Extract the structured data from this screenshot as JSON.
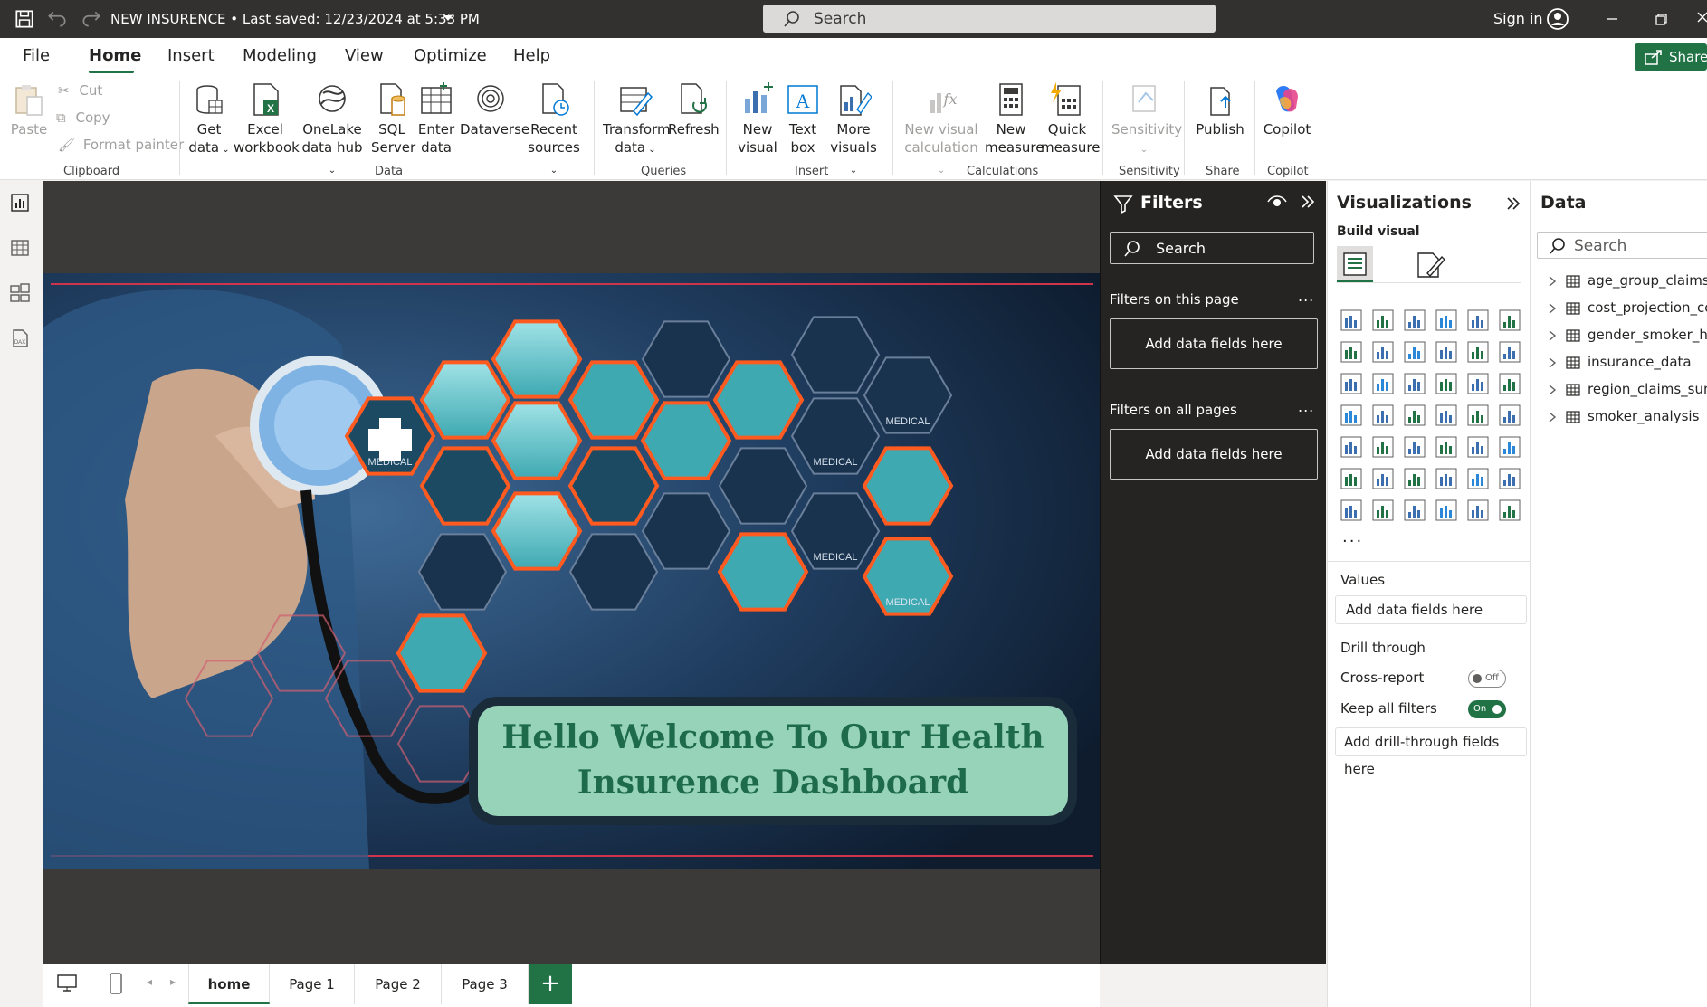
{
  "titlebar": {
    "title": "NEW INSURENCE • Last saved: 12/23/2024 at 5:33 PM",
    "search_placeholder": "Search",
    "signin": "Sign in"
  },
  "menu": {
    "tabs": [
      "File",
      "Home",
      "Insert",
      "Modeling",
      "View",
      "Optimize",
      "Help"
    ],
    "active": "Home",
    "share": "Share"
  },
  "ribbon": {
    "clipboard": {
      "paste": "Paste",
      "cut": "Cut",
      "copy": "Copy",
      "format_painter": "Format painter",
      "label": "Clipboard"
    },
    "data": {
      "get_data": [
        "Get",
        "data"
      ],
      "excel": [
        "Excel",
        "workbook"
      ],
      "onelake": [
        "OneLake",
        "data hub"
      ],
      "sql": [
        "SQL",
        "Server"
      ],
      "enter": [
        "Enter",
        "data"
      ],
      "dataverse": "Dataverse",
      "recent": [
        "Recent",
        "sources"
      ],
      "label": "Data"
    },
    "queries": {
      "transform": [
        "Transform",
        "data"
      ],
      "refresh": "Refresh",
      "label": "Queries"
    },
    "insert": {
      "new_visual": [
        "New",
        "visual"
      ],
      "text_box": [
        "Text",
        "box"
      ],
      "more_visuals": [
        "More",
        "visuals"
      ],
      "label": "Insert"
    },
    "calculations": {
      "new_visual_calc": [
        "New visual",
        "calculation"
      ],
      "new_measure": [
        "New",
        "measure"
      ],
      "quick_measure": [
        "Quick",
        "measure"
      ],
      "label": "Calculations"
    },
    "sensitivity": {
      "btn": "Sensitivity",
      "label": "Sensitivity"
    },
    "share": {
      "publish": "Publish",
      "label": "Share"
    },
    "copilot": {
      "btn": "Copilot",
      "label": "Copilot"
    }
  },
  "canvas": {
    "welcome_line1": "Hello Welcome To Our Health",
    "welcome_line2": "Insurence Dashboard",
    "hex_labels": [
      "MEDICAL",
      "MEDICAL",
      "MEDICAL",
      "MEDICAL",
      "MEDICAL",
      "MEDICAL"
    ]
  },
  "pages": {
    "tabs": [
      "home",
      "Page 1",
      "Page 2",
      "Page 3"
    ],
    "active": "home",
    "add": "+"
  },
  "filters": {
    "title": "Filters",
    "search": "Search",
    "on_this_page": "Filters on this page",
    "on_all_pages": "Filters on all pages",
    "dots": "...",
    "add_fields": "Add data fields here"
  },
  "visualizations": {
    "title": "Visualizations",
    "build_visual": "Build visual",
    "values": "Values",
    "add_fields": "Add data fields here",
    "drill_through": "Drill through",
    "cross_report": "Cross-report",
    "cross_report_state": "Off",
    "keep_filters": "Keep all filters",
    "keep_filters_state": "On",
    "add_drill": "Add drill-through fields here",
    "more": "..."
  },
  "data_pane": {
    "title": "Data",
    "search": "Search",
    "tables": [
      "age_group_claims_summary",
      "cost_projection_comparison",
      "gender_smoker_health_summary",
      "insurance_data",
      "region_claims_summary",
      "smoker_analysis"
    ]
  },
  "colors": {
    "accent": "#217346",
    "titlebar": "#323130",
    "canvas_bg": "#3b3a39",
    "filters_bg": "#252423",
    "welcome_box": "#97d3b9",
    "welcome_text": "#1e6b4c",
    "hex_orange": "#ff5a1f"
  }
}
